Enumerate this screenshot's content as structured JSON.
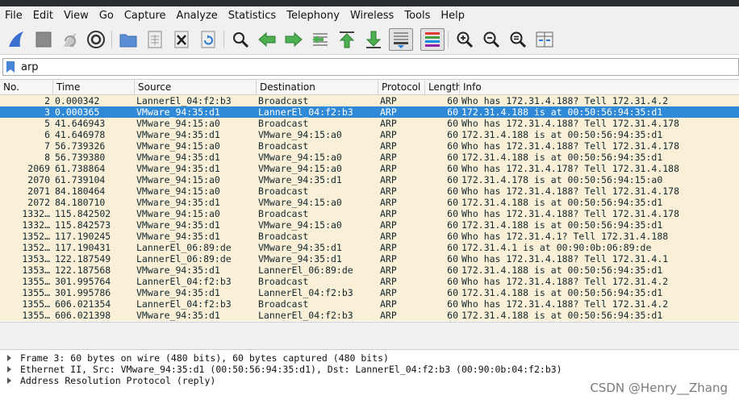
{
  "menu": [
    "File",
    "Edit",
    "View",
    "Go",
    "Capture",
    "Analyze",
    "Statistics",
    "Telephony",
    "Wireless",
    "Tools",
    "Help"
  ],
  "filter": {
    "value": "arp"
  },
  "columns": {
    "no": "No.",
    "time": "Time",
    "source": "Source",
    "destination": "Destination",
    "protocol": "Protocol",
    "length": "Length",
    "info": "Info"
  },
  "packets": [
    {
      "no": "2",
      "time": "0.000342",
      "source": "LannerEl_04:f2:b3",
      "destination": "Broadcast",
      "protocol": "ARP",
      "length": "60",
      "info": "Who has 172.31.4.188? Tell 172.31.4.2",
      "selected": false
    },
    {
      "no": "3",
      "time": "0.000365",
      "source": "VMware_94:35:d1",
      "destination": "LannerEl_04:f2:b3",
      "protocol": "ARP",
      "length": "60",
      "info": "172.31.4.188 is at 00:50:56:94:35:d1",
      "selected": true
    },
    {
      "no": "5",
      "time": "41.646943",
      "source": "VMware_94:15:a0",
      "destination": "Broadcast",
      "protocol": "ARP",
      "length": "60",
      "info": "Who has 172.31.4.188? Tell 172.31.4.178",
      "selected": false
    },
    {
      "no": "6",
      "time": "41.646978",
      "source": "VMware_94:35:d1",
      "destination": "VMware_94:15:a0",
      "protocol": "ARP",
      "length": "60",
      "info": "172.31.4.188 is at 00:50:56:94:35:d1",
      "selected": false
    },
    {
      "no": "7",
      "time": "56.739326",
      "source": "VMware_94:15:a0",
      "destination": "Broadcast",
      "protocol": "ARP",
      "length": "60",
      "info": "Who has 172.31.4.188? Tell 172.31.4.178",
      "selected": false
    },
    {
      "no": "8",
      "time": "56.739380",
      "source": "VMware_94:35:d1",
      "destination": "VMware_94:15:a0",
      "protocol": "ARP",
      "length": "60",
      "info": "172.31.4.188 is at 00:50:56:94:35:d1",
      "selected": false
    },
    {
      "no": "2069",
      "time": "61.738864",
      "source": "VMware_94:35:d1",
      "destination": "VMware_94:15:a0",
      "protocol": "ARP",
      "length": "60",
      "info": "Who has 172.31.4.178? Tell 172.31.4.188",
      "selected": false
    },
    {
      "no": "2070",
      "time": "61.739104",
      "source": "VMware_94:15:a0",
      "destination": "VMware_94:35:d1",
      "protocol": "ARP",
      "length": "60",
      "info": "172.31.4.178 is at 00:50:56:94:15:a0",
      "selected": false
    },
    {
      "no": "2071",
      "time": "84.180464",
      "source": "VMware_94:15:a0",
      "destination": "Broadcast",
      "protocol": "ARP",
      "length": "60",
      "info": "Who has 172.31.4.188? Tell 172.31.4.178",
      "selected": false
    },
    {
      "no": "2072",
      "time": "84.180710",
      "source": "VMware_94:35:d1",
      "destination": "VMware_94:15:a0",
      "protocol": "ARP",
      "length": "60",
      "info": "172.31.4.188 is at 00:50:56:94:35:d1",
      "selected": false
    },
    {
      "no": "1332…",
      "time": "115.842502",
      "source": "VMware_94:15:a0",
      "destination": "Broadcast",
      "protocol": "ARP",
      "length": "60",
      "info": "Who has 172.31.4.188? Tell 172.31.4.178",
      "selected": false
    },
    {
      "no": "1332…",
      "time": "115.842573",
      "source": "VMware_94:35:d1",
      "destination": "VMware_94:15:a0",
      "protocol": "ARP",
      "length": "60",
      "info": "172.31.4.188 is at 00:50:56:94:35:d1",
      "selected": false
    },
    {
      "no": "1352…",
      "time": "117.190245",
      "source": "VMware_94:35:d1",
      "destination": "Broadcast",
      "protocol": "ARP",
      "length": "60",
      "info": "Who has 172.31.4.1? Tell 172.31.4.188",
      "selected": false
    },
    {
      "no": "1352…",
      "time": "117.190431",
      "source": "LannerEl_06:89:de",
      "destination": "VMware_94:35:d1",
      "protocol": "ARP",
      "length": "60",
      "info": "172.31.4.1 is at 00:90:0b:06:89:de",
      "selected": false
    },
    {
      "no": "1353…",
      "time": "122.187549",
      "source": "LannerEl_06:89:de",
      "destination": "VMware_94:35:d1",
      "protocol": "ARP",
      "length": "60",
      "info": "Who has 172.31.4.188? Tell 172.31.4.1",
      "selected": false
    },
    {
      "no": "1353…",
      "time": "122.187568",
      "source": "VMware_94:35:d1",
      "destination": "LannerEl_06:89:de",
      "protocol": "ARP",
      "length": "60",
      "info": "172.31.4.188 is at 00:50:56:94:35:d1",
      "selected": false
    },
    {
      "no": "1355…",
      "time": "301.995764",
      "source": "LannerEl_04:f2:b3",
      "destination": "Broadcast",
      "protocol": "ARP",
      "length": "60",
      "info": "Who has 172.31.4.188? Tell 172.31.4.2",
      "selected": false
    },
    {
      "no": "1355…",
      "time": "301.995786",
      "source": "VMware_94:35:d1",
      "destination": "LannerEl_04:f2:b3",
      "protocol": "ARP",
      "length": "60",
      "info": "172.31.4.188 is at 00:50:56:94:35:d1",
      "selected": false
    },
    {
      "no": "1355…",
      "time": "606.021354",
      "source": "LannerEl_04:f2:b3",
      "destination": "Broadcast",
      "protocol": "ARP",
      "length": "60",
      "info": "Who has 172.31.4.188? Tell 172.31.4.2",
      "selected": false
    },
    {
      "no": "1355…",
      "time": "606.021398",
      "source": "VMware_94:35:d1",
      "destination": "LannerEl_04:f2:b3",
      "protocol": "ARP",
      "length": "60",
      "info": "172.31.4.188 is at 00:50:56:94:35:d1",
      "selected": false
    }
  ],
  "details": [
    "Frame 3: 60 bytes on wire (480 bits), 60 bytes captured (480 bits)",
    "Ethernet II, Src: VMware_94:35:d1 (00:50:56:94:35:d1), Dst: LannerEl_04:f2:b3 (00:90:0b:04:f2:b3)",
    "Address Resolution Protocol (reply)"
  ],
  "watermark": "CSDN @Henry__Zhang",
  "colors": {
    "row_bg": "#faf0d7",
    "selected_bg": "#2f89d6",
    "toolbar_bg": "#f0f0f0"
  }
}
